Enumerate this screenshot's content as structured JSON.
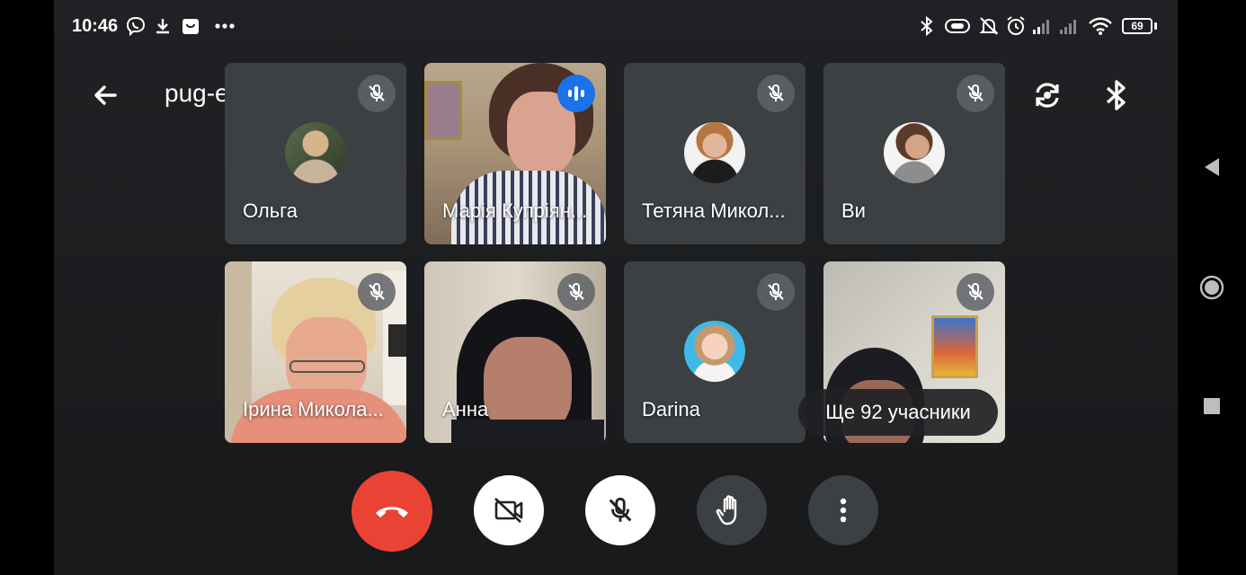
{
  "status_bar": {
    "time": "10:46",
    "battery": "69"
  },
  "top_bar": {
    "meeting_code": "pug-eirg-ego"
  },
  "participants": [
    {
      "name": "Ольга",
      "state": "muted"
    },
    {
      "name": "Марія Купріян...",
      "state": "speaking"
    },
    {
      "name": "Тетяна Микол...",
      "state": "muted"
    },
    {
      "name": "Ви",
      "state": "muted"
    },
    {
      "name": "Ірина Микола...",
      "state": "muted"
    },
    {
      "name": "Анна",
      "state": "muted"
    },
    {
      "name": "Darina",
      "state": "muted"
    },
    {
      "name": "",
      "state": "muted"
    }
  ],
  "more_participants": "Ще 92 учасники",
  "controls": {
    "end_call": "phone-hangup-icon",
    "camera": "camera-off-icon",
    "mic": "mic-off-icon",
    "raise_hand": "raise-hand-icon",
    "more": "more-vert-icon"
  },
  "colors": {
    "end_call": "#ea4335",
    "speaking": "#1a73e8",
    "background": "#202124"
  }
}
